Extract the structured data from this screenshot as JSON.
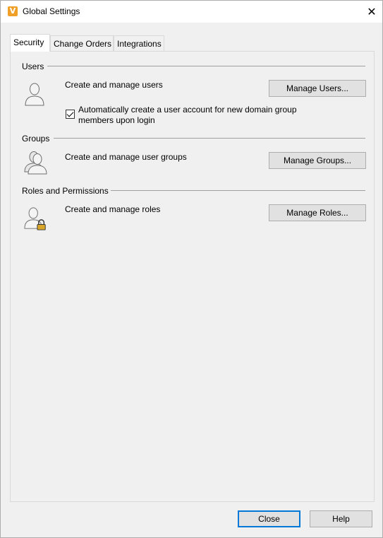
{
  "window": {
    "title": "Global Settings",
    "app_icon_letter": "V",
    "close_glyph": "✕"
  },
  "tabs": [
    {
      "label": "Security",
      "active": true
    },
    {
      "label": "Change Orders",
      "active": false
    },
    {
      "label": "Integrations",
      "active": false
    }
  ],
  "security": {
    "users": {
      "heading": "Users",
      "description": "Create and manage users",
      "button": "Manage Users...",
      "auto_create": {
        "checked": true,
        "label": "Automatically create a user account for new domain group members upon login"
      }
    },
    "groups": {
      "heading": "Groups",
      "description": "Create and manage user groups",
      "button": "Manage Groups..."
    },
    "roles": {
      "heading": "Roles and Permissions",
      "description": "Create and manage roles",
      "button": "Manage Roles..."
    }
  },
  "footer": {
    "close_label": "Close",
    "help_label": "Help"
  },
  "icons": {
    "app": "vault-app-icon",
    "users": "user-icon",
    "groups": "group-icon",
    "roles": "user-lock-icon"
  },
  "colors": {
    "accent": "#0078d7",
    "app_icon": "#f0a028"
  }
}
